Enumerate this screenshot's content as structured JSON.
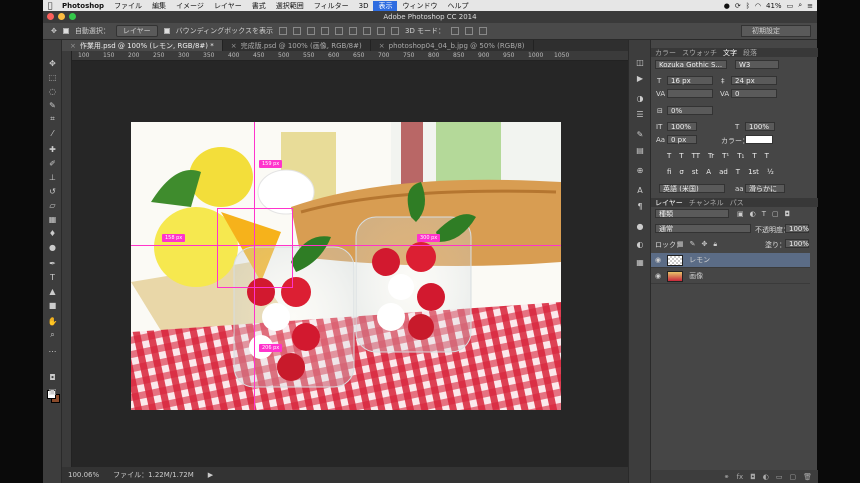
{
  "menubar": {
    "app": "Photoshop",
    "items": [
      "ファイル",
      "編集",
      "イメージ",
      "レイヤー",
      "書式",
      "選択範囲",
      "フィルター",
      "3D",
      "表示",
      "ウィンドウ",
      "ヘルプ"
    ],
    "active_item": "表示",
    "battery": "41%",
    "status_icons": [
      "camera-icon",
      "sync-icon",
      "bluetooth-icon",
      "wifi-icon",
      "battery-icon",
      "search-icon",
      "list-icon"
    ]
  },
  "window": {
    "title": "Adobe Photoshop CC 2014"
  },
  "options": {
    "auto_select_label": "自動選択：",
    "auto_select_value": "レイヤー",
    "bounding_box_label": "バウンディングボックスを表示",
    "mode_3d_label": "3D モード：",
    "preset": "初期設定"
  },
  "tabs": [
    {
      "label": "作業用.psd @ 100% (レモン, RGB/8#) *",
      "active": true
    },
    {
      "label": "完成版.psd @ 100% (画像, RGB/8#)",
      "active": false
    },
    {
      "label": "photoshop04_04_b.jpg @ 50% (RGB/8)",
      "active": false
    }
  ],
  "ruler": [
    "100",
    "150",
    "200",
    "250",
    "300",
    "350",
    "400",
    "450",
    "500",
    "550",
    "600",
    "650",
    "700",
    "750",
    "800",
    "850",
    "900",
    "950",
    "1000",
    "1050"
  ],
  "measurements": [
    "159 px",
    "158 px",
    "300 px",
    "206 px"
  ],
  "status": {
    "zoom": "100.06%",
    "file": "ファイル：1.22M/1.72M"
  },
  "char_panel": {
    "tabs": [
      "カラー",
      "スウォッチ",
      "文字",
      "段落"
    ],
    "active_tab": "文字",
    "font_family": "Kozuka Gothic S...",
    "font_style": "W3",
    "size": "16 px",
    "leading": "24 px",
    "kerning": "",
    "tracking": "0",
    "tsume": "0%",
    "vscale": "100%",
    "hscale": "100%",
    "baseline": "0 px",
    "color_label": "カラー：",
    "language": "英語 (米国)",
    "antialias": "滑らかに",
    "styles": [
      "T",
      "T",
      "TT",
      "Tr",
      "T¹",
      "T₁",
      "T",
      "T"
    ],
    "otfeatures": [
      "fi",
      "σ",
      "st",
      "A",
      "ad",
      "T",
      "1st",
      "½"
    ]
  },
  "layers_panel": {
    "tabs": [
      "レイヤー",
      "チャンネル",
      "パス"
    ],
    "active_tab": "レイヤー",
    "kind": "種類",
    "blend": "通常",
    "opacity_label": "不透明度：",
    "opacity": "100%",
    "lock_label": "ロック：",
    "fill_label": "塗り：",
    "fill": "100%",
    "layers": [
      {
        "name": "レモン",
        "selected": true
      },
      {
        "name": "画像",
        "selected": false
      }
    ]
  }
}
